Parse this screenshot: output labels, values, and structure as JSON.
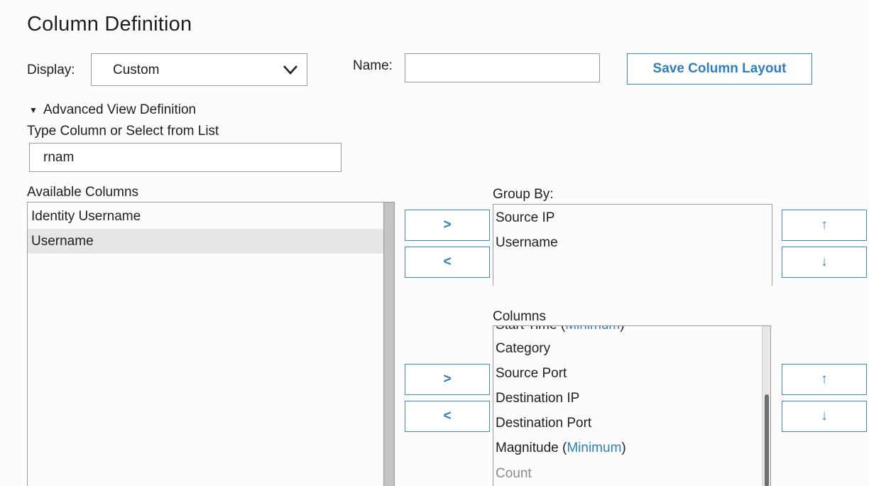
{
  "title": "Column Definition",
  "display": {
    "label": "Display:",
    "value": "Custom"
  },
  "name": {
    "label": "Name:",
    "value": ""
  },
  "save_button": "Save Column Layout",
  "advanced": {
    "label": "Advanced View Definition"
  },
  "search": {
    "label": "Type Column or Select from List",
    "value": "rnam"
  },
  "available": {
    "label": "Available Columns",
    "items": [
      "Identity Username",
      "Username"
    ],
    "selected": "Username"
  },
  "group_by": {
    "label": "Group By:",
    "items": [
      "Source IP",
      "Username"
    ]
  },
  "columns": {
    "label": "Columns",
    "partial_top": {
      "name": "Start Time",
      "agg": "Minimum"
    },
    "items": [
      {
        "name": "Category",
        "agg": ""
      },
      {
        "name": "Source Port",
        "agg": ""
      },
      {
        "name": "Destination IP",
        "agg": ""
      },
      {
        "name": "Destination Port",
        "agg": ""
      },
      {
        "name": "Magnitude",
        "agg": "Minimum"
      },
      {
        "name": "Count",
        "agg": ""
      }
    ]
  },
  "buttons": {
    "add": ">",
    "remove": "<",
    "up": "↑",
    "down": "↓"
  },
  "colors": {
    "accent": "#2f7ec1",
    "selected_row": "#e6e6e6",
    "border": "#9a9a9a"
  }
}
